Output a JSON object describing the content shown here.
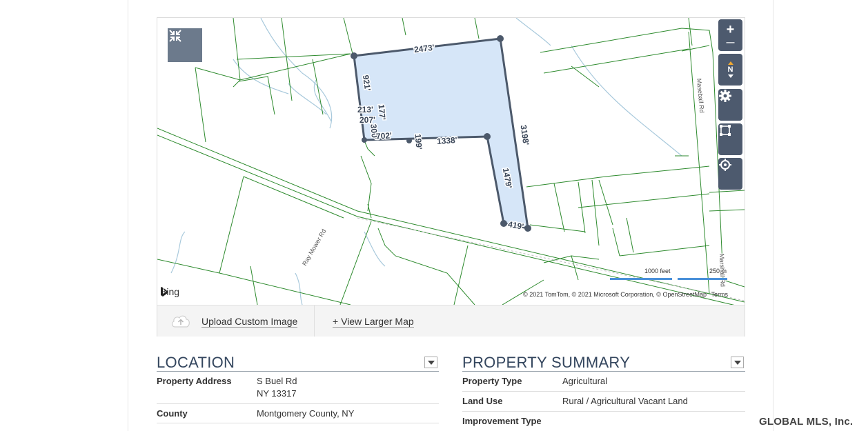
{
  "map": {
    "edge_labels": [
      "2473'",
      "921'",
      "213'",
      "177'",
      "207'",
      "300'",
      "702'",
      "199'",
      "1338'",
      "3198'",
      "1479'",
      "419'"
    ],
    "road_labels": [
      "Ray Mower Rd",
      "Maseball Rd",
      "Marshall Rd"
    ],
    "attribution": {
      "provider": "Bing",
      "copyright": "© 2021 TomTom, © 2021 Microsoft Corporation, © OpenStreetMap",
      "terms": "Terms"
    },
    "scale": {
      "feet": "1000 feet",
      "meters": "250 m"
    },
    "controls": {
      "zoom_in": "+",
      "zoom_out": "—",
      "compass": "N"
    },
    "colors": {
      "parcel_fill": "#d6e6f8",
      "parcel_stroke": "#4c596b",
      "lines": "#2d8a2d",
      "water": "#a8c9dc"
    }
  },
  "toolbar": {
    "upload_label": "Upload Custom Image",
    "view_larger_label": "+ View Larger Map"
  },
  "location": {
    "title": "LOCATION",
    "rows": [
      {
        "label": "Property Address",
        "value_line1": "S Buel Rd",
        "value_line2": "NY 13317"
      },
      {
        "label": "County",
        "value": "Montgomery County, NY"
      }
    ]
  },
  "summary": {
    "title": "PROPERTY SUMMARY",
    "rows": [
      {
        "label": "Property Type",
        "value": "Agricultural"
      },
      {
        "label": "Land Use",
        "value": "Rural / Agricultural Vacant Land"
      },
      {
        "label": "Improvement Type",
        "value": ""
      }
    ]
  },
  "brand": "GLOBAL MLS, Inc."
}
